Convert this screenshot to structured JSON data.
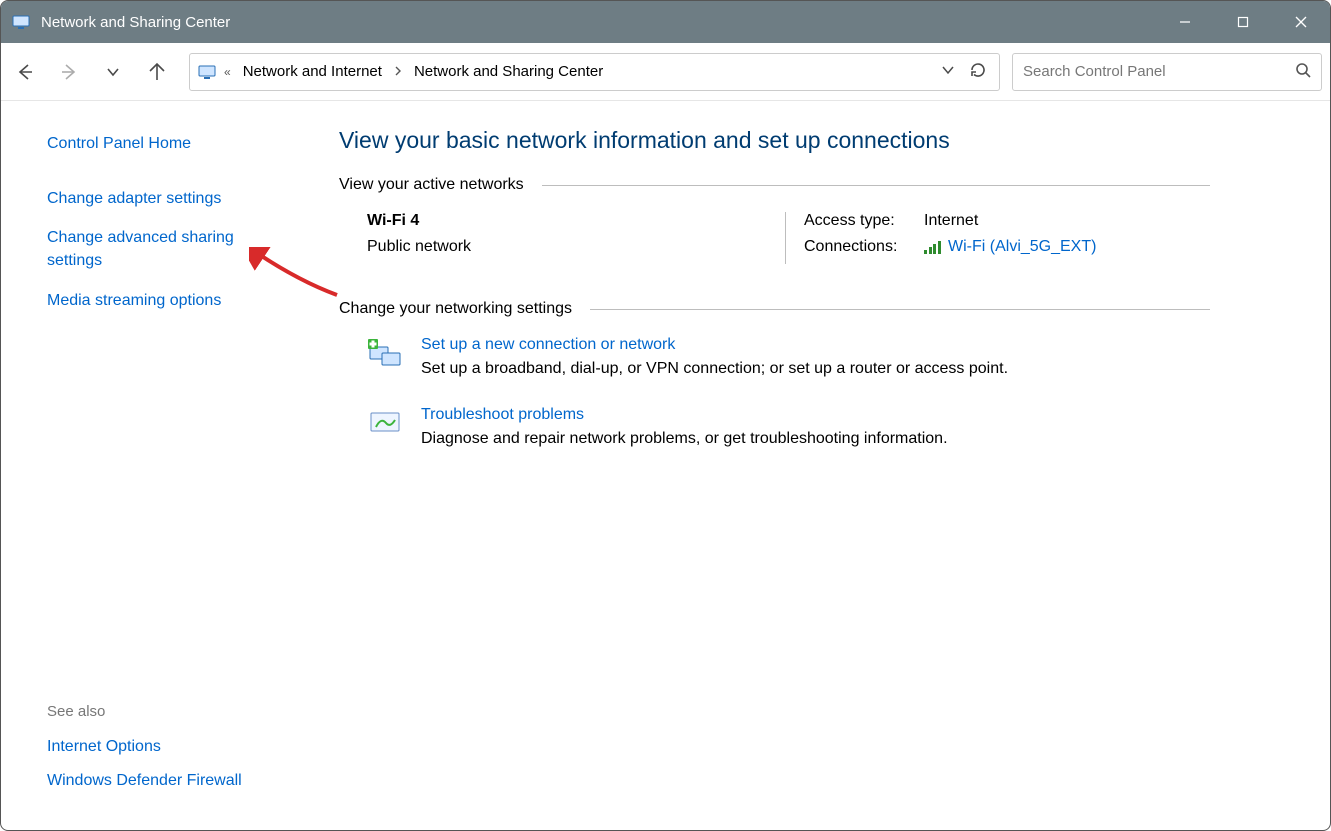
{
  "window": {
    "title": "Network and Sharing Center"
  },
  "breadcrumb": {
    "parent": "Network and Internet",
    "current": "Network and Sharing Center"
  },
  "search": {
    "placeholder": "Search Control Panel"
  },
  "sidebar": {
    "home": "Control Panel Home",
    "links": [
      "Change adapter settings",
      "Change advanced sharing settings",
      "Media streaming options"
    ],
    "see_also_header": "See also",
    "see_also": [
      "Internet Options",
      "Windows Defender Firewall"
    ]
  },
  "main": {
    "title": "View your basic network information and set up connections",
    "section_active": "View your active networks",
    "network": {
      "name": "Wi-Fi 4",
      "type": "Public network",
      "access_label": "Access type:",
      "access_value": "Internet",
      "conn_label": "Connections:",
      "conn_value": "Wi-Fi (Alvi_5G_EXT)"
    },
    "section_change": "Change your networking settings",
    "items": [
      {
        "title": "Set up a new connection or network",
        "desc": "Set up a broadband, dial-up, or VPN connection; or set up a router or access point."
      },
      {
        "title": "Troubleshoot problems",
        "desc": "Diagnose and repair network problems, or get troubleshooting information."
      }
    ]
  }
}
